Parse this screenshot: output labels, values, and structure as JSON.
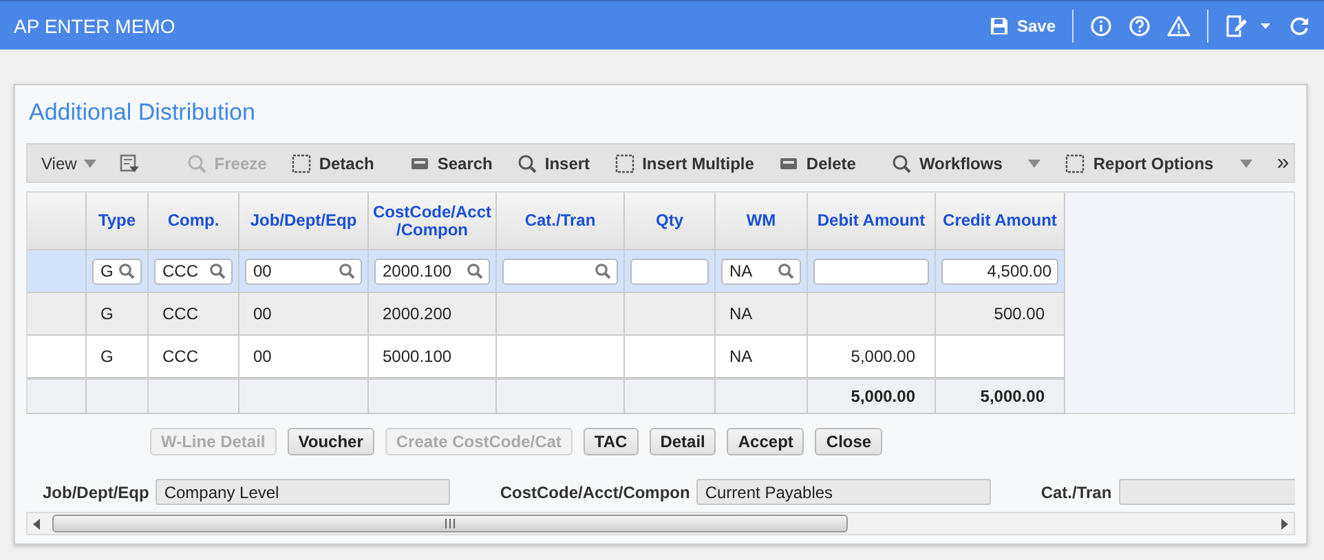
{
  "window": {
    "title": "AP ENTER MEMO"
  },
  "header_actions": [
    {
      "kind": "save",
      "label": "Save"
    },
    {
      "kind": "info"
    },
    {
      "kind": "help"
    },
    {
      "kind": "warning"
    },
    {
      "kind": "notes"
    },
    {
      "kind": "refresh"
    }
  ],
  "heading": "Additional Distribution",
  "toolbar": [
    {
      "kind": "menu",
      "label": "View",
      "disabled": false
    },
    {
      "kind": "icon"
    },
    {
      "kind": "button",
      "label": "Freeze",
      "disabled": true
    },
    {
      "kind": "button",
      "label": "Detach",
      "disabled": false
    },
    {
      "kind": "button",
      "label": "Search",
      "disabled": false
    },
    {
      "kind": "button",
      "label": "Insert",
      "disabled": false
    },
    {
      "kind": "button",
      "label": "Insert Multiple",
      "disabled": false
    },
    {
      "kind": "button",
      "label": "Delete",
      "disabled": false
    },
    {
      "kind": "dropdown",
      "label": "Workflows",
      "disabled": false
    },
    {
      "kind": "dropdown",
      "label": "Report Options",
      "disabled": false
    },
    {
      "kind": "more",
      "label": "»"
    }
  ],
  "table": {
    "columns": [
      {
        "label": "Type",
        "kind": "text"
      },
      {
        "label": "Comp.",
        "kind": "text"
      },
      {
        "label": "Job/Dept/Eqp",
        "kind": "text"
      },
      {
        "label": "CostCode/Acct /Compon",
        "kind": "text"
      },
      {
        "label": "Cat./Tran",
        "kind": "text"
      },
      {
        "label": "Qty",
        "kind": "text"
      },
      {
        "label": "WM",
        "kind": "text"
      },
      {
        "label": "Debit Amount",
        "kind": "amount"
      },
      {
        "label": "Credit Amount",
        "kind": "amount"
      }
    ],
    "entry_row": [
      {
        "value": "G",
        "lookup": true
      },
      {
        "value": "CCC",
        "lookup": true
      },
      {
        "value": "00",
        "lookup": true
      },
      {
        "value": "2000.100",
        "lookup": true
      },
      {
        "lookup": true
      },
      {
        "lookup": false
      },
      {
        "value": "NA",
        "lookup": true
      },
      {
        "lookup": false
      },
      {
        "value": "4,500.00",
        "lookup": false
      }
    ],
    "rows": [
      {
        "type": "G",
        "comp": "CCC",
        "job": "00",
        "costcode": "2000.200",
        "wm": "NA",
        "credit": "500.00"
      },
      {
        "type": "G",
        "comp": "CCC",
        "job": "00",
        "costcode": "5000.100",
        "wm": "NA",
        "debit": "5,000.00"
      }
    ],
    "totals": {
      "debit": "5,000.00",
      "credit": "5,000.00"
    }
  },
  "buttons": [
    {
      "label": "W-Line Detail",
      "disabled": true
    },
    {
      "label": "Voucher",
      "disabled": false
    },
    {
      "label": "Create CostCode/Cat",
      "disabled": true
    },
    {
      "label": "TAC",
      "disabled": false
    },
    {
      "label": "Detail",
      "disabled": false
    },
    {
      "label": "Accept",
      "disabled": false
    },
    {
      "label": "Close",
      "disabled": false
    }
  ],
  "info_fields": [
    {
      "label": "Job/Dept/Eqp",
      "value": "Company Level"
    },
    {
      "label": "CostCode/Acct/Compon",
      "value": "Current Payables"
    },
    {
      "label": "Cat./Tran"
    }
  ]
}
